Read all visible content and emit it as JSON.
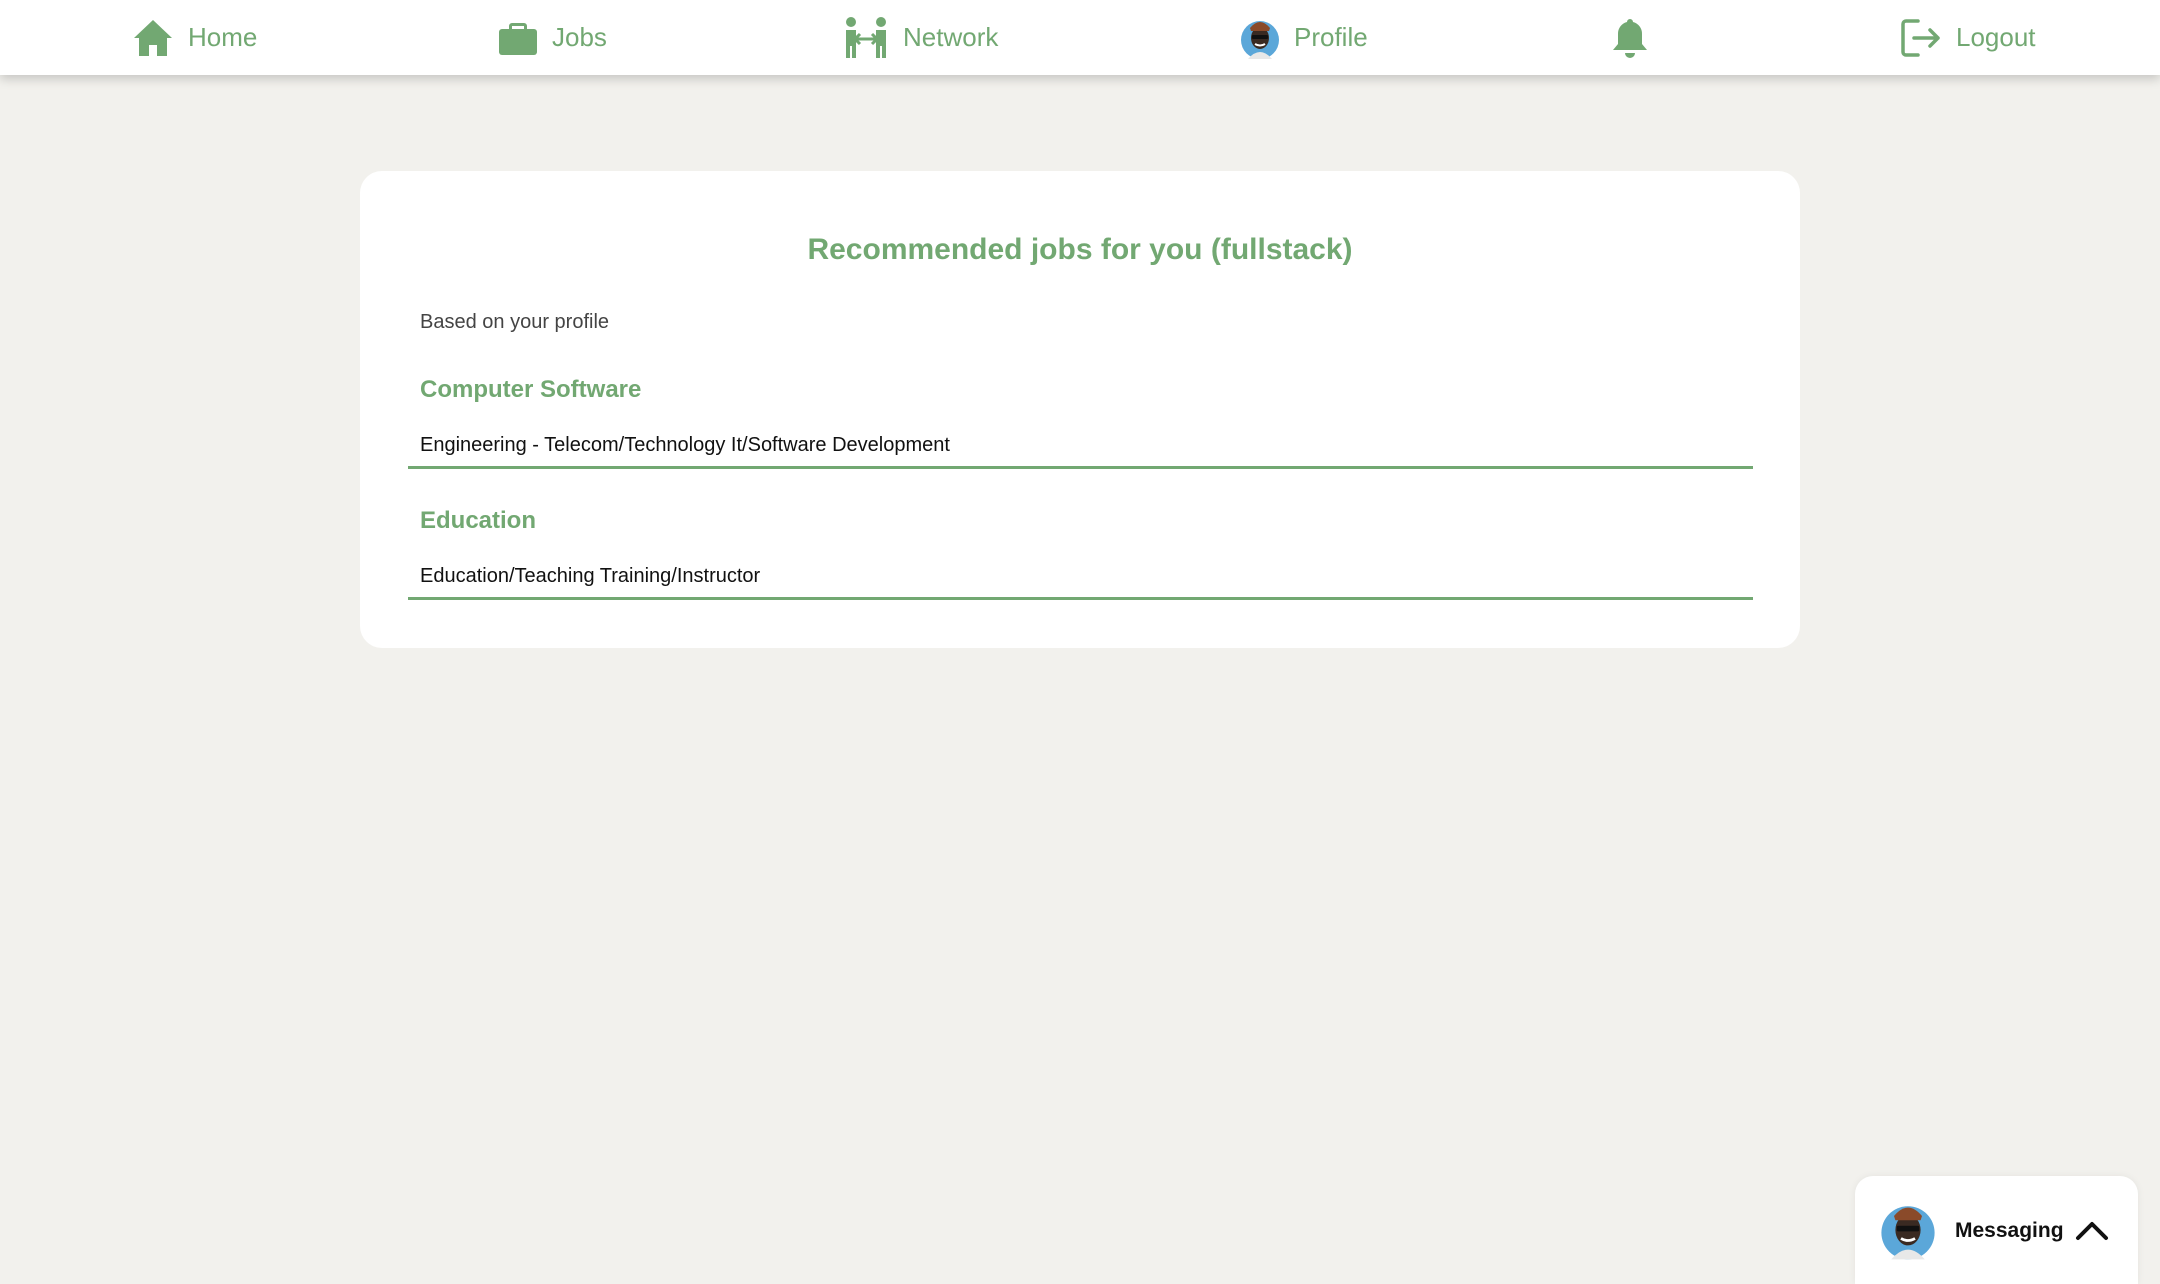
{
  "nav": {
    "home": "Home",
    "jobs": "Jobs",
    "network": "Network",
    "profile": "Profile",
    "logout": "Logout"
  },
  "card": {
    "title": "Recommended jobs for you (fullstack)",
    "subtitle": "Based on your profile",
    "jobs": [
      {
        "industry": "Computer Software",
        "category": "Engineering - Telecom/Technology It/Software Development"
      },
      {
        "industry": "Education",
        "category": "Education/Teaching Training/Instructor"
      }
    ]
  },
  "messaging": {
    "label": "Messaging"
  },
  "colors": {
    "accent": "#72a872",
    "background": "#f2f1ed",
    "card": "#ffffff"
  },
  "icons": [
    "home-icon",
    "briefcase-icon",
    "network-icon",
    "profile-avatar",
    "bell-icon",
    "logout-icon",
    "chevron-up-icon"
  ]
}
